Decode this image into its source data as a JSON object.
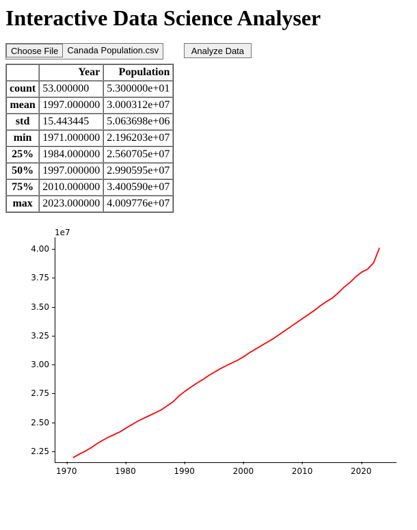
{
  "title": "Interactive Data Science Analyser",
  "controls": {
    "choose_file_label": "Choose File",
    "selected_filename": "Canada Population.csv",
    "analyze_label": "Analyze Data"
  },
  "stats_table": {
    "columns": [
      "",
      "Year",
      "Population"
    ],
    "rows": [
      {
        "label": "count",
        "year": "53.000000",
        "pop": "5.300000e+01"
      },
      {
        "label": "mean",
        "year": "1997.000000",
        "pop": "3.000312e+07"
      },
      {
        "label": "std",
        "year": "15.443445",
        "pop": "5.063698e+06"
      },
      {
        "label": "min",
        "year": "1971.000000",
        "pop": "2.196203e+07"
      },
      {
        "label": "25%",
        "year": "1984.000000",
        "pop": "2.560705e+07"
      },
      {
        "label": "50%",
        "year": "1997.000000",
        "pop": "2.990595e+07"
      },
      {
        "label": "75%",
        "year": "2010.000000",
        "pop": "3.400590e+07"
      },
      {
        "label": "max",
        "year": "2023.000000",
        "pop": "4.009776e+07"
      }
    ]
  },
  "chart_data": {
    "type": "line",
    "title": "",
    "xlabel": "",
    "ylabel": "",
    "y_scale_label": "1e7",
    "xlim": [
      1968,
      2026
    ],
    "ylim": [
      21500000,
      41000000
    ],
    "x_ticks": [
      1970,
      1980,
      1990,
      2000,
      2010,
      2020
    ],
    "y_ticks": [
      22500000,
      25000000,
      27500000,
      30000000,
      32500000,
      35000000,
      37500000,
      40000000
    ],
    "y_tick_labels": [
      "2.25",
      "2.50",
      "2.75",
      "3.00",
      "3.25",
      "3.50",
      "3.75",
      "4.00"
    ],
    "series": [
      {
        "name": "Population",
        "color": "#ff0000",
        "x": [
          1971,
          1972,
          1973,
          1974,
          1975,
          1976,
          1977,
          1978,
          1979,
          1980,
          1981,
          1982,
          1983,
          1984,
          1985,
          1986,
          1987,
          1988,
          1989,
          1990,
          1991,
          1992,
          1993,
          1994,
          1995,
          1996,
          1997,
          1998,
          1999,
          2000,
          2001,
          2002,
          2003,
          2004,
          2005,
          2006,
          2007,
          2008,
          2009,
          2010,
          2011,
          2012,
          2013,
          2014,
          2015,
          2016,
          2017,
          2018,
          2019,
          2020,
          2021,
          2022,
          2023
        ],
        "y": [
          21962030,
          22250000,
          22500000,
          22800000,
          23150000,
          23450000,
          23730000,
          23960000,
          24200000,
          24520000,
          24820000,
          25120000,
          25370000,
          25607050,
          25850000,
          26100000,
          26450000,
          26800000,
          27300000,
          27700000,
          28050000,
          28400000,
          28700000,
          29050000,
          29350000,
          29650000,
          29905950,
          30150000,
          30400000,
          30700000,
          31050000,
          31350000,
          31650000,
          31950000,
          32250000,
          32600000,
          32950000,
          33300000,
          33650000,
          34005900,
          34350000,
          34700000,
          35100000,
          35450000,
          35750000,
          36200000,
          36700000,
          37100000,
          37600000,
          38000000,
          38250000,
          38800000,
          40097760
        ]
      }
    ]
  }
}
